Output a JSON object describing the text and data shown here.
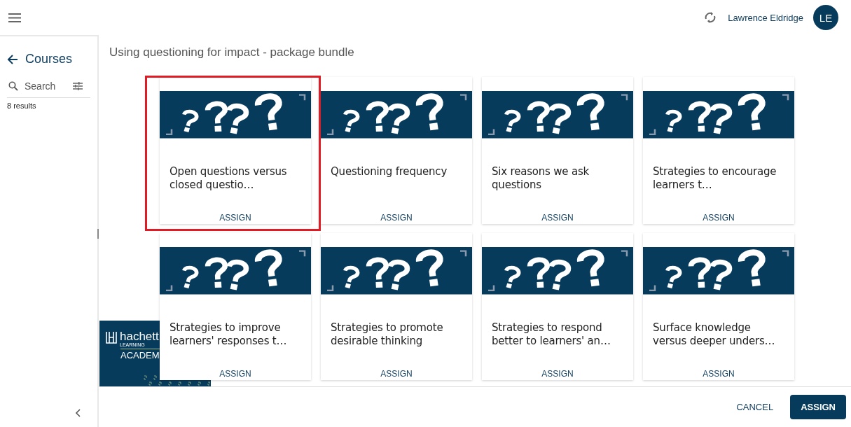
{
  "header": {
    "user_name": "Lawrence Eldridge",
    "avatar_initials": "LE"
  },
  "sidebar": {
    "title": "Courses",
    "search": {
      "placeholder": "Search"
    },
    "results": "8 results"
  },
  "page_title": "Using questioning for impact - package bundle",
  "cards": [
    {
      "title": "Open questions versus closed questio…",
      "action": "ASSIGN",
      "highlighted": true
    },
    {
      "title": "Questioning frequency",
      "action": "ASSIGN",
      "highlighted": false
    },
    {
      "title": "Six reasons we ask questions",
      "action": "ASSIGN",
      "highlighted": false
    },
    {
      "title": "Strategies to encourage learners t…",
      "action": "ASSIGN",
      "highlighted": false
    },
    {
      "title": "Strategies to improve learners' responses t…",
      "action": "ASSIGN",
      "highlighted": false
    },
    {
      "title": "Strategies to promote desirable thinking",
      "action": "ASSIGN",
      "highlighted": false
    },
    {
      "title": "Strategies to respond better to learners' an…",
      "action": "ASSIGN",
      "highlighted": false
    },
    {
      "title": "Surface knowledge versus deeper unders…",
      "action": "ASSIGN",
      "highlighted": false
    }
  ],
  "logo": {
    "name": "hachett",
    "sub": "LEARNING",
    "line": "ACADEM"
  },
  "footer": {
    "buttons": [
      "CANCEL",
      "ASSIGN"
    ]
  }
}
